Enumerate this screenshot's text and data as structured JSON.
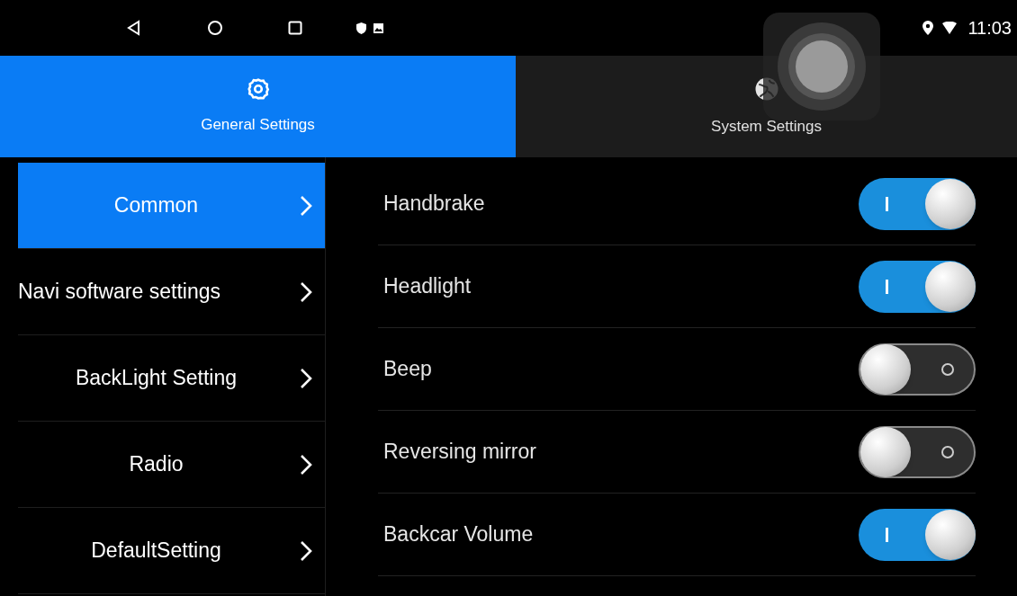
{
  "status_bar": {
    "time": "11:03"
  },
  "tabs": [
    {
      "label": "General Settings",
      "selected": true,
      "kind": "gear"
    },
    {
      "label": "System Settings",
      "selected": false,
      "kind": "globe"
    }
  ],
  "sidebar": {
    "items": [
      {
        "label": "Common",
        "selected": true
      },
      {
        "label": "Navi software settings",
        "selected": false
      },
      {
        "label": "BackLight Setting",
        "selected": false
      },
      {
        "label": "Radio",
        "selected": false
      },
      {
        "label": "DefaultSetting",
        "selected": false
      }
    ]
  },
  "settings": [
    {
      "label": "Handbrake",
      "on": true
    },
    {
      "label": "Headlight",
      "on": true
    },
    {
      "label": "Beep",
      "on": false
    },
    {
      "label": "Reversing mirror",
      "on": false
    },
    {
      "label": "Backcar Volume",
      "on": true
    }
  ]
}
